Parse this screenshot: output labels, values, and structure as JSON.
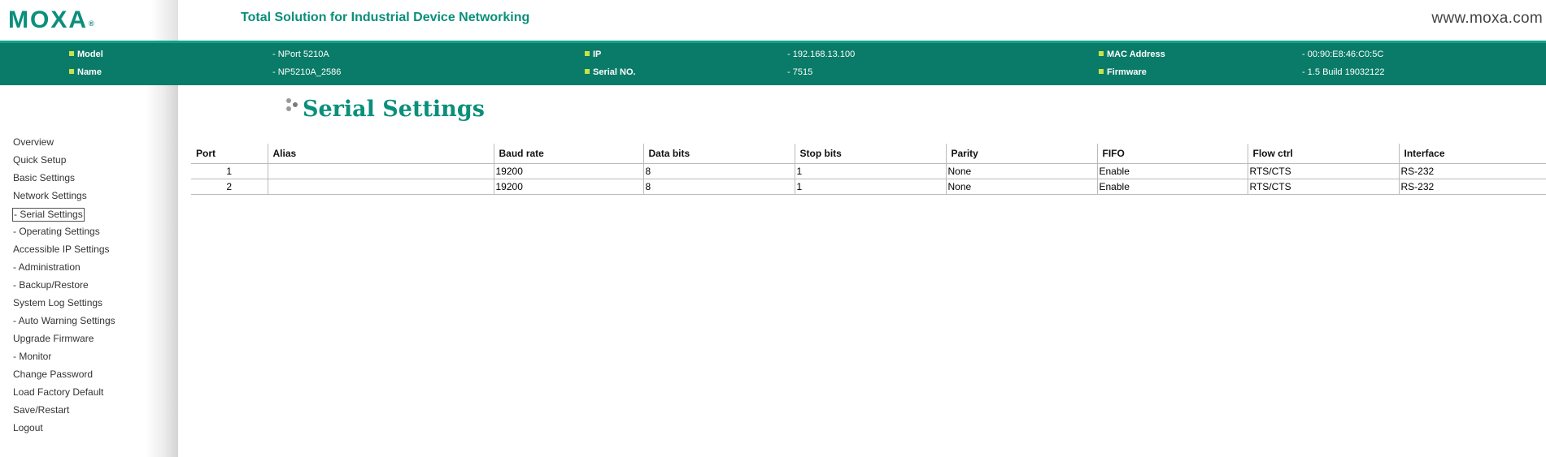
{
  "header": {
    "logo_text": "MOXA",
    "logo_mark": "®",
    "tagline": "Total Solution for Industrial Device Networking",
    "site_url": "www.moxa.com"
  },
  "device_info": {
    "model_label": "Model",
    "model_value": "- NPort 5210A",
    "name_label": "Name",
    "name_value": "- NP5210A_2586",
    "ip_label": "IP",
    "ip_value": "- 192.168.13.100",
    "serial_label": "Serial NO.",
    "serial_value": "- 7515",
    "mac_label": "MAC Address",
    "mac_value": "- 00:90:E8:46:C0:5C",
    "firmware_label": "Firmware",
    "firmware_value": "- 1.5 Build 19032122"
  },
  "sidebar": {
    "items": [
      {
        "label": "Overview"
      },
      {
        "label": "Quick Setup"
      },
      {
        "label": "Basic Settings"
      },
      {
        "label": "Network Settings"
      },
      {
        "label": "- Serial Settings",
        "active": true
      },
      {
        "label": "- Operating Settings"
      },
      {
        "label": "Accessible IP Settings"
      },
      {
        "label": "- Administration"
      },
      {
        "label": "- Backup/Restore"
      },
      {
        "label": "System Log Settings"
      },
      {
        "label": "- Auto Warning Settings"
      },
      {
        "label": "Upgrade Firmware"
      },
      {
        "label": "- Monitor"
      },
      {
        "label": "Change Password"
      },
      {
        "label": "Load Factory Default"
      },
      {
        "label": "Save/Restart"
      },
      {
        "label": "Logout"
      }
    ]
  },
  "main": {
    "title": "Serial Settings",
    "table": {
      "headers": [
        "Port",
        "Alias",
        "Baud rate",
        "Data bits",
        "Stop bits",
        "Parity",
        "FIFO",
        "Flow ctrl",
        "Interface"
      ],
      "rows": [
        [
          "1",
          "",
          "19200",
          "8",
          "1",
          "None",
          "Enable",
          "RTS/CTS",
          "RS-232"
        ],
        [
          "2",
          "",
          "19200",
          "8",
          "1",
          "None",
          "Enable",
          "RTS/CTS",
          "RS-232"
        ]
      ]
    }
  },
  "colors": {
    "brand_green": "#0a8f7b",
    "info_bar": "#0a7b68",
    "bullet": "#c9e24a"
  },
  "icons": {
    "title_bullet": "dots-icon",
    "info_bullet": "square-bullet-icon"
  }
}
